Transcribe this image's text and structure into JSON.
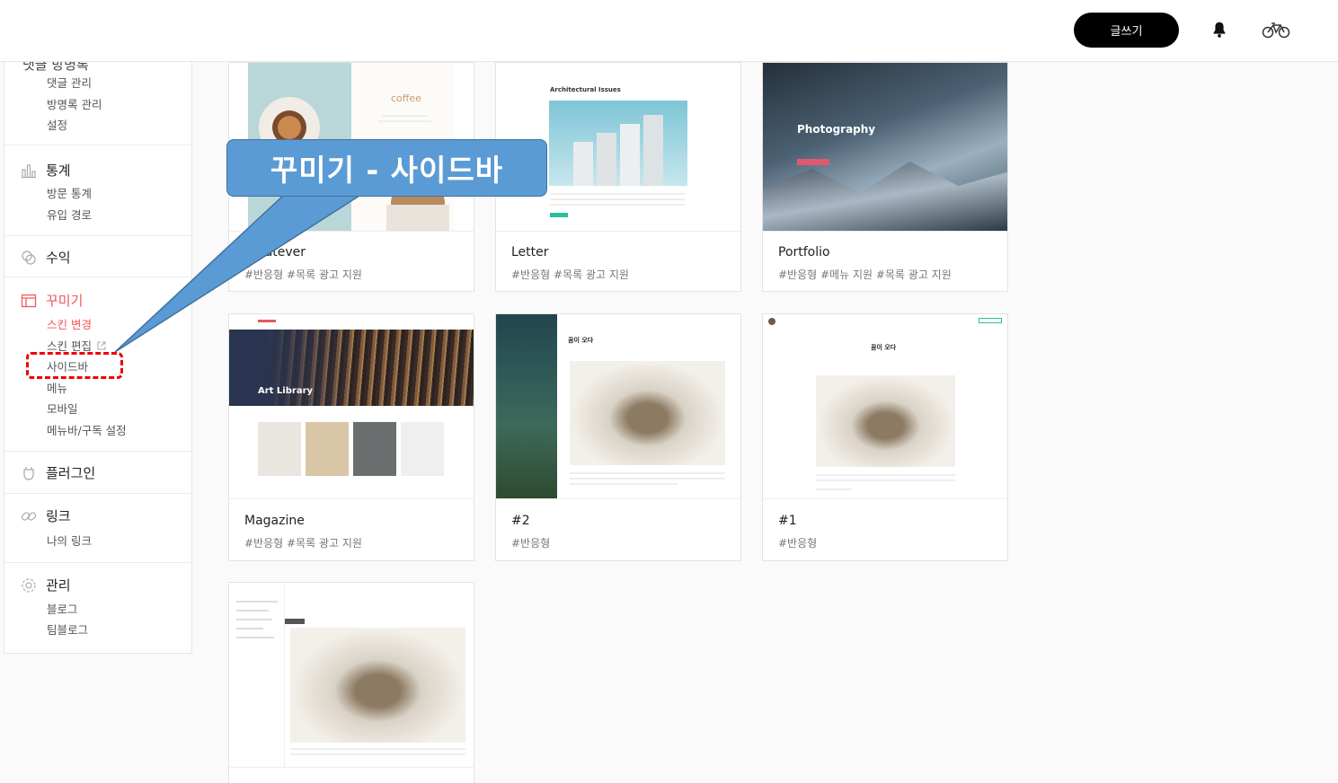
{
  "header": {
    "write_label": "글쓰기"
  },
  "sidebar": {
    "top_partial_label": "댓글 방명록",
    "sections": [
      {
        "title": "",
        "items": [
          "댓글 관리",
          "방명록 관리",
          "설정"
        ]
      },
      {
        "title": "통계",
        "items": [
          "방문 통계",
          "유입 경로"
        ]
      },
      {
        "title": "수익",
        "items": []
      },
      {
        "title": "꾸미기",
        "items": [
          "스킨 변경",
          "스킨 편집",
          "사이드바",
          "메뉴",
          "모바일",
          "메뉴바/구독 설정"
        ]
      },
      {
        "title": "플러그인",
        "items": []
      },
      {
        "title": "링크",
        "items": [
          "나의 링크"
        ]
      },
      {
        "title": "관리",
        "items": [
          "블로그",
          "팀블로그"
        ]
      }
    ]
  },
  "callout": {
    "text": "꾸미기 - 사이드바"
  },
  "skins": [
    {
      "name": "Whatever",
      "tags": "#반응형   #목록 광고 지원",
      "thumb_text": "coffee"
    },
    {
      "name": "Letter",
      "tags": "#반응형   #목록 광고 지원",
      "thumb_text": "Architectural Issues"
    },
    {
      "name": "Portfolio",
      "tags": "#반응형   #메뉴 지원   #목록 광고 지원",
      "thumb_text": "Photography"
    },
    {
      "name": "Magazine",
      "tags": "#반응형   #목록 광고 지원",
      "thumb_text": "Art Library"
    },
    {
      "name": "#2",
      "tags": "#반응형",
      "thumb_text": "꿈이 오다"
    },
    {
      "name": "#1",
      "tags": "#반응형",
      "thumb_text": "꿈이 오다"
    },
    {
      "name": "",
      "tags": "",
      "thumb_text": ""
    }
  ],
  "colors": {
    "accent": "#f0565c",
    "callout": "#5b9bd5",
    "dash": "#e00000"
  }
}
